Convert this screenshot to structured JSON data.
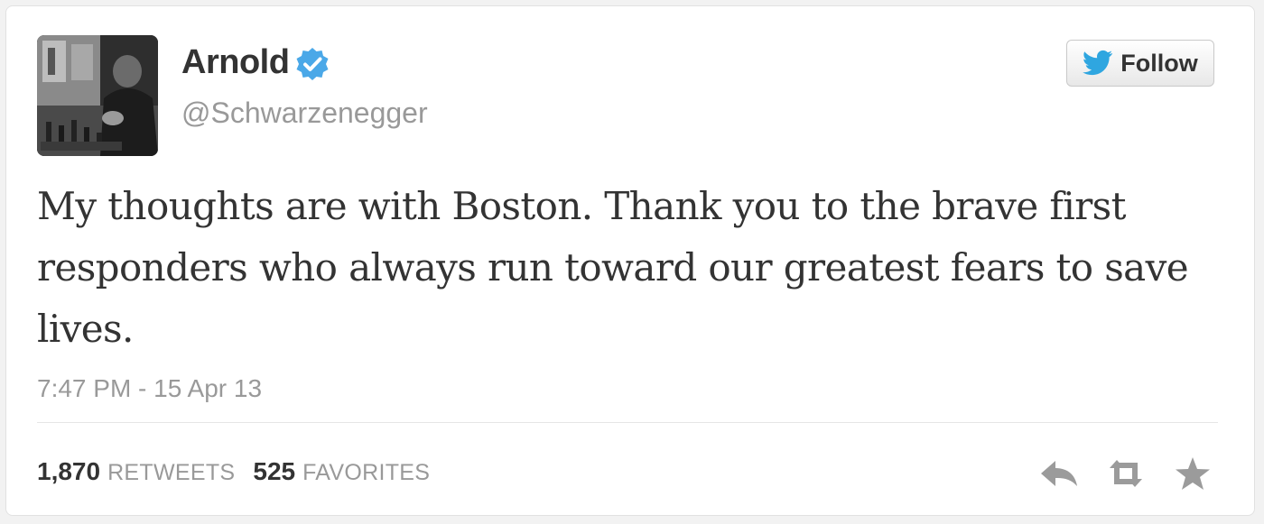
{
  "user": {
    "name": "Arnold",
    "handle": "@Schwarzenegger",
    "verified": true
  },
  "follow_button": {
    "label": "Follow"
  },
  "tweet": {
    "text": "My thoughts are with Boston. Thank you to the brave first responders who always run toward our greatest fears to save lives.",
    "timestamp": "7:47 PM - 15 Apr 13"
  },
  "stats": {
    "retweets_count": "1,870",
    "retweets_label": "RETWEETS",
    "favorites_count": "525",
    "favorites_label": "FAVORITES"
  },
  "actions": {
    "reply_icon": "reply-icon",
    "retweet_icon": "retweet-icon",
    "favorite_icon": "star-icon"
  },
  "colors": {
    "verified_blue": "#4aa8e8",
    "twitter_blue": "#2fa6e0",
    "text_dark": "#333333",
    "text_muted": "#999999",
    "icon_gray": "#9b9b9b"
  }
}
